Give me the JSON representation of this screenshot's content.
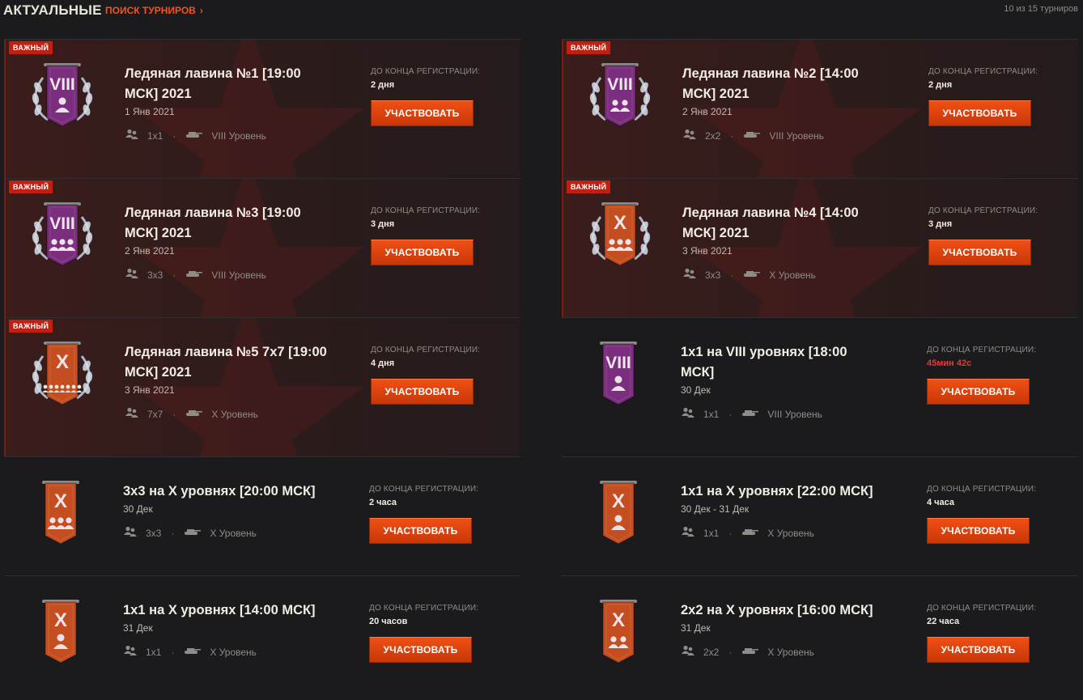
{
  "header": {
    "title": "АКТУАЛЬНЫЕ",
    "search_link": "ПОИСК ТУРНИРОВ",
    "count": "10 из 15 турниров"
  },
  "common": {
    "reg_label": "ДО КОНЦА РЕГИСТРАЦИИ:",
    "button_label": "УЧАСТВОВАТЬ",
    "badge_label": "ВАЖНЫЙ",
    "separator": "·"
  },
  "tournaments": [
    {
      "title": "Ледяная лавина №1 [19:00 МСК] 2021",
      "date": "1 Янв 2021",
      "format": "1x1",
      "level": "VIII Уровень",
      "reg_left": "2 дня",
      "featured": true,
      "emblem": "VIII",
      "emblem_color": "#7b2d7e",
      "emblem_people": 1,
      "urgent": false
    },
    {
      "title": "Ледяная лавина №2 [14:00 МСК] 2021",
      "date": "2 Янв 2021",
      "format": "2x2",
      "level": "VIII Уровень",
      "reg_left": "2 дня",
      "featured": true,
      "emblem": "VIII",
      "emblem_color": "#7b2d7e",
      "emblem_people": 2,
      "urgent": false
    },
    {
      "title": "Ледяная лавина №3 [19:00 МСК] 2021",
      "date": "2 Янв 2021",
      "format": "3x3",
      "level": "VIII Уровень",
      "reg_left": "3 дня",
      "featured": true,
      "emblem": "VIII",
      "emblem_color": "#7b2d7e",
      "emblem_people": 3,
      "urgent": false
    },
    {
      "title": "Ледяная лавина №4 [14:00 МСК] 2021",
      "date": "3 Янв 2021",
      "format": "3x3",
      "level": "X Уровень",
      "reg_left": "3 дня",
      "featured": true,
      "emblem": "X",
      "emblem_color": "#c54e21",
      "emblem_people": 3,
      "urgent": false
    },
    {
      "title": "Ледяная лавина №5 7x7 [19:00 МСК] 2021",
      "date": "3 Янв 2021",
      "format": "7x7",
      "level": "X Уровень",
      "reg_left": "4 дня",
      "featured": true,
      "emblem": "X",
      "emblem_color": "#c54e21",
      "emblem_people": 7,
      "urgent": false
    },
    {
      "title": "1x1 на VIII уровнях [18:00 МСК]",
      "date": "30 Дек",
      "format": "1x1",
      "level": "VIII Уровень",
      "reg_left": "45мин 42с",
      "featured": false,
      "emblem": "VIII",
      "emblem_color": "#7b2d7e",
      "emblem_people": 1,
      "urgent": true
    },
    {
      "title": "3x3 на X уровнях [20:00 МСК]",
      "date": "30 Дек",
      "format": "3x3",
      "level": "X Уровень",
      "reg_left": "2 часа",
      "featured": false,
      "emblem": "X",
      "emblem_color": "#c54e21",
      "emblem_people": 3,
      "urgent": false
    },
    {
      "title": "1x1 на X уровнях [22:00 МСК]",
      "date": "30 Дек - 31 Дек",
      "format": "1x1",
      "level": "X Уровень",
      "reg_left": "4 часа",
      "featured": false,
      "emblem": "X",
      "emblem_color": "#c54e21",
      "emblem_people": 1,
      "urgent": false
    },
    {
      "title": "1x1 на X уровнях [14:00 МСК]",
      "date": "31 Дек",
      "format": "1x1",
      "level": "X Уровень",
      "reg_left": "20 часов",
      "featured": false,
      "emblem": "X",
      "emblem_color": "#c54e21",
      "emblem_people": 1,
      "urgent": false
    },
    {
      "title": "2x2 на X уровнях [16:00 МСК]",
      "date": "31 Дек",
      "format": "2x2",
      "level": "X Уровень",
      "reg_left": "22 часа",
      "featured": false,
      "emblem": "X",
      "emblem_color": "#c54e21",
      "emblem_people": 2,
      "urgent": false
    }
  ],
  "colors": {
    "accent": "#f25322",
    "button": "#e04810",
    "badge": "#c11f11",
    "urgent": "#e53a3a"
  }
}
